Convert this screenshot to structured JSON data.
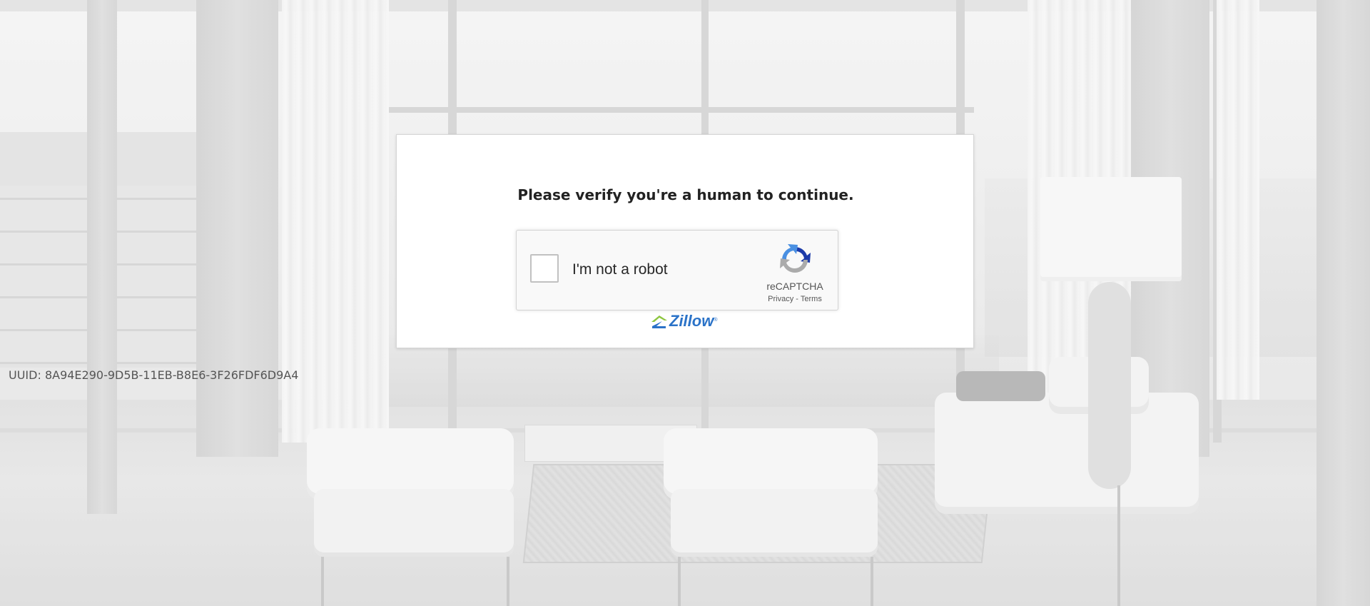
{
  "uuid_text": "UUID: 8A94E290-9D5B-11EB-B8E6-3F26FDF6D9A4",
  "dialog": {
    "title": "Please verify you're a human to continue."
  },
  "recaptcha": {
    "checkbox_label": "I'm not a robot",
    "brand": "reCAPTCHA",
    "privacy_link": "Privacy",
    "separator": "-",
    "terms_link": "Terms",
    "checked": false
  },
  "logo": {
    "name": "Zillow",
    "trademark": "®"
  },
  "icons": {
    "recaptcha": "recaptcha-logo-icon",
    "zillow": "zillow-logo-icon"
  },
  "colors": {
    "zillow_blue": "#2b73c8",
    "zillow_green": "#8dc63f",
    "recaptcha_blue": "#1c3aa9",
    "recaptcha_lightblue": "#4a90e2",
    "recaptcha_gray": "#ababab"
  }
}
